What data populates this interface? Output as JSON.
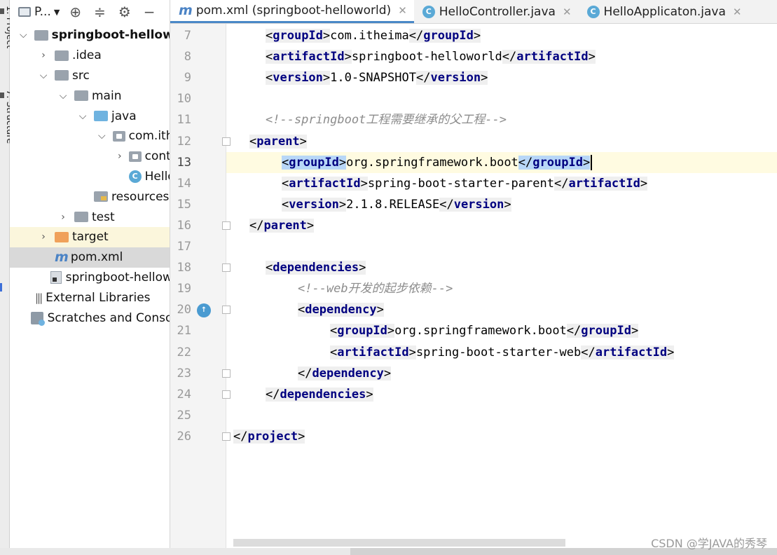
{
  "side_strip": {
    "project_tab": "1: Project",
    "structure_tab": "7: Structure"
  },
  "project_panel": {
    "title": "P...",
    "toolbar_icons": [
      "locate-icon",
      "collapse-icon",
      "gear-icon",
      "minimize-icon"
    ],
    "tree": [
      {
        "label": "springboot-helloworld",
        "icon": "module-folder-icon",
        "level": 0,
        "expanded": "open",
        "bold": true
      },
      {
        "label": ".idea",
        "icon": "folder-icon",
        "level": 1,
        "expanded": "closed"
      },
      {
        "label": "src",
        "icon": "folder-icon",
        "level": 1,
        "expanded": "open"
      },
      {
        "label": "main",
        "icon": "folder-icon",
        "level": 2,
        "expanded": "open"
      },
      {
        "label": "java",
        "icon": "source-folder-icon",
        "level": 3,
        "expanded": "open"
      },
      {
        "label": "com.itheima",
        "icon": "package-icon",
        "level": 4,
        "expanded": "open"
      },
      {
        "label": "controller",
        "icon": "package-icon",
        "level": 5,
        "expanded": "closed"
      },
      {
        "label": "HelloApplicaton",
        "icon": "spring-class-icon",
        "level": 5,
        "expanded": "none"
      },
      {
        "label": "resources",
        "icon": "resources-folder-icon",
        "level": 3,
        "expanded": "none"
      },
      {
        "label": "test",
        "icon": "folder-icon",
        "level": 2,
        "expanded": "closed"
      },
      {
        "label": "target",
        "icon": "excluded-folder-icon",
        "level": 1,
        "expanded": "closed",
        "highlight": "yellow"
      },
      {
        "label": "pom.xml",
        "icon": "maven-icon",
        "level": 1,
        "expanded": "none",
        "highlight": "grey"
      },
      {
        "label": "springboot-helloworld.iml",
        "icon": "iml-file-icon",
        "level": 1,
        "expanded": "none"
      },
      {
        "label": "External Libraries",
        "icon": "libraries-icon",
        "level": 0,
        "expanded": "none"
      },
      {
        "label": "Scratches and Consoles",
        "icon": "scratches-icon",
        "level": 0,
        "expanded": "none"
      }
    ]
  },
  "tabs": [
    {
      "label": "pom.xml (springboot-helloworld)",
      "icon": "maven-icon",
      "active": true
    },
    {
      "label": "HelloController.java",
      "icon": "class-icon",
      "active": false
    },
    {
      "label": "HelloApplicaton.java",
      "icon": "spring-class-icon",
      "active": false
    }
  ],
  "editor": {
    "current_line": "13",
    "lines": [
      {
        "n": "7",
        "indent": 2,
        "tokens": [
          {
            "t": "<",
            "c": "tx",
            "box": true
          },
          {
            "t": "groupId",
            "c": "tg",
            "box": true
          },
          {
            "t": ">",
            "c": "tx",
            "box": true
          },
          {
            "t": "com.itheima",
            "c": "tx"
          },
          {
            "t": "</",
            "c": "tx",
            "box": true
          },
          {
            "t": "groupId",
            "c": "tg",
            "box": true
          },
          {
            "t": ">",
            "c": "tx",
            "box": true
          }
        ]
      },
      {
        "n": "8",
        "indent": 2,
        "tokens": [
          {
            "t": "<",
            "c": "tx",
            "box": true
          },
          {
            "t": "artifactId",
            "c": "tg",
            "box": true
          },
          {
            "t": ">",
            "c": "tx",
            "box": true
          },
          {
            "t": "springboot-helloworld",
            "c": "tx"
          },
          {
            "t": "</",
            "c": "tx",
            "box": true
          },
          {
            "t": "artifactId",
            "c": "tg",
            "box": true
          },
          {
            "t": ">",
            "c": "tx",
            "box": true
          }
        ]
      },
      {
        "n": "9",
        "indent": 2,
        "tokens": [
          {
            "t": "<",
            "c": "tx",
            "box": true
          },
          {
            "t": "version",
            "c": "tg",
            "box": true
          },
          {
            "t": ">",
            "c": "tx",
            "box": true
          },
          {
            "t": "1.0-SNAPSHOT",
            "c": "tx"
          },
          {
            "t": "</",
            "c": "tx",
            "box": true
          },
          {
            "t": "version",
            "c": "tg",
            "box": true
          },
          {
            "t": ">",
            "c": "tx",
            "box": true
          }
        ]
      },
      {
        "n": "10",
        "indent": 0,
        "tokens": []
      },
      {
        "n": "11",
        "indent": 2,
        "tokens": [
          {
            "t": "<!--springboot工程需要继承的父工程-->",
            "c": "cm"
          }
        ]
      },
      {
        "n": "12",
        "indent": 1,
        "fold": true,
        "tokens": [
          {
            "t": "<",
            "c": "tx",
            "box": true
          },
          {
            "t": "parent",
            "c": "tg",
            "box": true
          },
          {
            "t": ">",
            "c": "tx",
            "box": true
          }
        ]
      },
      {
        "n": "13",
        "indent": 3,
        "current": true,
        "tokens": [
          {
            "t": "<",
            "c": "tx",
            "hl": true
          },
          {
            "t": "groupId",
            "c": "tg",
            "hl": true
          },
          {
            "t": ">",
            "c": "tx",
            "hl": true
          },
          {
            "t": "org.springframework.boot",
            "c": "tx"
          },
          {
            "t": "</",
            "c": "tx",
            "hl": true
          },
          {
            "t": "groupId",
            "c": "tg",
            "hl": true
          },
          {
            "t": ">",
            "c": "tx",
            "hl": true
          }
        ],
        "caret": true
      },
      {
        "n": "14",
        "indent": 3,
        "tokens": [
          {
            "t": "<",
            "c": "tx",
            "box": true
          },
          {
            "t": "artifactId",
            "c": "tg",
            "box": true
          },
          {
            "t": ">",
            "c": "tx",
            "box": true
          },
          {
            "t": "spring-boot-starter-parent",
            "c": "tx"
          },
          {
            "t": "</",
            "c": "tx",
            "box": true
          },
          {
            "t": "artifactId",
            "c": "tg",
            "box": true
          },
          {
            "t": ">",
            "c": "tx",
            "box": true
          }
        ]
      },
      {
        "n": "15",
        "indent": 3,
        "tokens": [
          {
            "t": "<",
            "c": "tx",
            "box": true
          },
          {
            "t": "version",
            "c": "tg",
            "box": true
          },
          {
            "t": ">",
            "c": "tx",
            "box": true
          },
          {
            "t": "2.1.8.RELEASE",
            "c": "tx"
          },
          {
            "t": "</",
            "c": "tx",
            "box": true
          },
          {
            "t": "version",
            "c": "tg",
            "box": true
          },
          {
            "t": ">",
            "c": "tx",
            "box": true
          }
        ]
      },
      {
        "n": "16",
        "indent": 1,
        "fold": true,
        "tokens": [
          {
            "t": "</",
            "c": "tx",
            "box": true
          },
          {
            "t": "parent",
            "c": "tg",
            "box": true
          },
          {
            "t": ">",
            "c": "tx",
            "box": true
          }
        ]
      },
      {
        "n": "17",
        "indent": 0,
        "tokens": []
      },
      {
        "n": "18",
        "indent": 2,
        "fold": true,
        "tokens": [
          {
            "t": "<",
            "c": "tx",
            "box": true
          },
          {
            "t": "dependencies",
            "c": "tg",
            "box": true
          },
          {
            "t": ">",
            "c": "tx",
            "box": true
          }
        ]
      },
      {
        "n": "19",
        "indent": 4,
        "tokens": [
          {
            "t": "<!--web开发的起步依赖-->",
            "c": "cm"
          }
        ]
      },
      {
        "n": "20",
        "indent": 4,
        "fold": true,
        "gutter_icon": true,
        "tokens": [
          {
            "t": "<",
            "c": "tx",
            "box": true
          },
          {
            "t": "dependency",
            "c": "tg",
            "box": true
          },
          {
            "t": ">",
            "c": "tx",
            "box": true
          }
        ]
      },
      {
        "n": "21",
        "indent": 6,
        "tokens": [
          {
            "t": "<",
            "c": "tx",
            "box": true
          },
          {
            "t": "groupId",
            "c": "tg",
            "box": true
          },
          {
            "t": ">",
            "c": "tx",
            "box": true
          },
          {
            "t": "org.springframework.boot",
            "c": "tx"
          },
          {
            "t": "</",
            "c": "tx",
            "box": true
          },
          {
            "t": "groupId",
            "c": "tg",
            "box": true
          },
          {
            "t": ">",
            "c": "tx",
            "box": true
          }
        ]
      },
      {
        "n": "22",
        "indent": 6,
        "tokens": [
          {
            "t": "<",
            "c": "tx",
            "box": true
          },
          {
            "t": "artifactId",
            "c": "tg",
            "box": true
          },
          {
            "t": ">",
            "c": "tx",
            "box": true
          },
          {
            "t": "spring-boot-starter-web",
            "c": "tx"
          },
          {
            "t": "</",
            "c": "tx",
            "box": true
          },
          {
            "t": "artifactId",
            "c": "tg",
            "box": true
          },
          {
            "t": ">",
            "c": "tx",
            "box": true
          }
        ]
      },
      {
        "n": "23",
        "indent": 4,
        "fold": true,
        "tokens": [
          {
            "t": "</",
            "c": "tx",
            "box": true
          },
          {
            "t": "dependency",
            "c": "tg",
            "box": true
          },
          {
            "t": ">",
            "c": "tx",
            "box": true
          }
        ]
      },
      {
        "n": "24",
        "indent": 2,
        "fold": true,
        "tokens": [
          {
            "t": "</",
            "c": "tx",
            "box": true
          },
          {
            "t": "dependencies",
            "c": "tg",
            "box": true
          },
          {
            "t": ">",
            "c": "tx",
            "box": true
          }
        ]
      },
      {
        "n": "25",
        "indent": 0,
        "tokens": []
      },
      {
        "n": "26",
        "indent": 0,
        "fold": true,
        "tokens": [
          {
            "t": "</",
            "c": "tx",
            "box": true
          },
          {
            "t": "project",
            "c": "tg",
            "box": true
          },
          {
            "t": ">",
            "c": "tx",
            "box": true
          }
        ]
      }
    ]
  },
  "watermark": "CSDN @学JAVA的秀琴"
}
